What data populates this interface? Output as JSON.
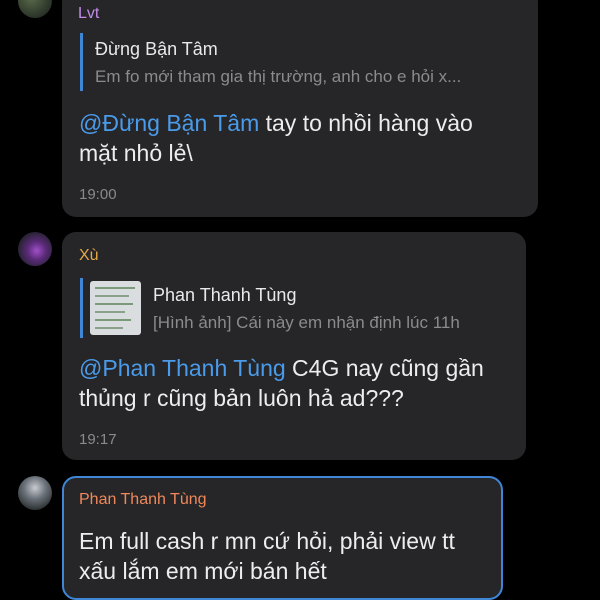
{
  "messages": [
    {
      "sender": "Lvt",
      "reply": {
        "name": "Đừng Bận Tâm",
        "text": "Em fo mới tham gia thị trường, anh cho e hỏi x..."
      },
      "mention": "@Đừng Bận Tâm",
      "text_line1": " tay to nhồi hàng vào",
      "text_line2": "mặt nhỏ lẻ\\",
      "time": "19:00"
    },
    {
      "sender": "Xù",
      "reply": {
        "name": "Phan Thanh Tùng",
        "text": "[Hình ảnh] Cái này em nhận định lúc 11h"
      },
      "mention": "@Phan Thanh Tùng",
      "text_line1": " C4G nay cũng gần",
      "text_line2": "thủng r cũng bản luôn hả ad???",
      "time": "19:17"
    },
    {
      "sender": "Phan Thanh Tùng",
      "text_line1": "Em full cash r mn cứ hỏi, phải view tt",
      "text_line2": "xấu lắm em mới bán hết"
    }
  ],
  "colors": {
    "sender_lvt": "#c48ae8",
    "sender_xu": "#e8a84a",
    "sender_phan": "#f0885a",
    "mention": "#4a9bea",
    "reply_bar": "#3f86d6",
    "selected_border": "#3f86d6"
  }
}
